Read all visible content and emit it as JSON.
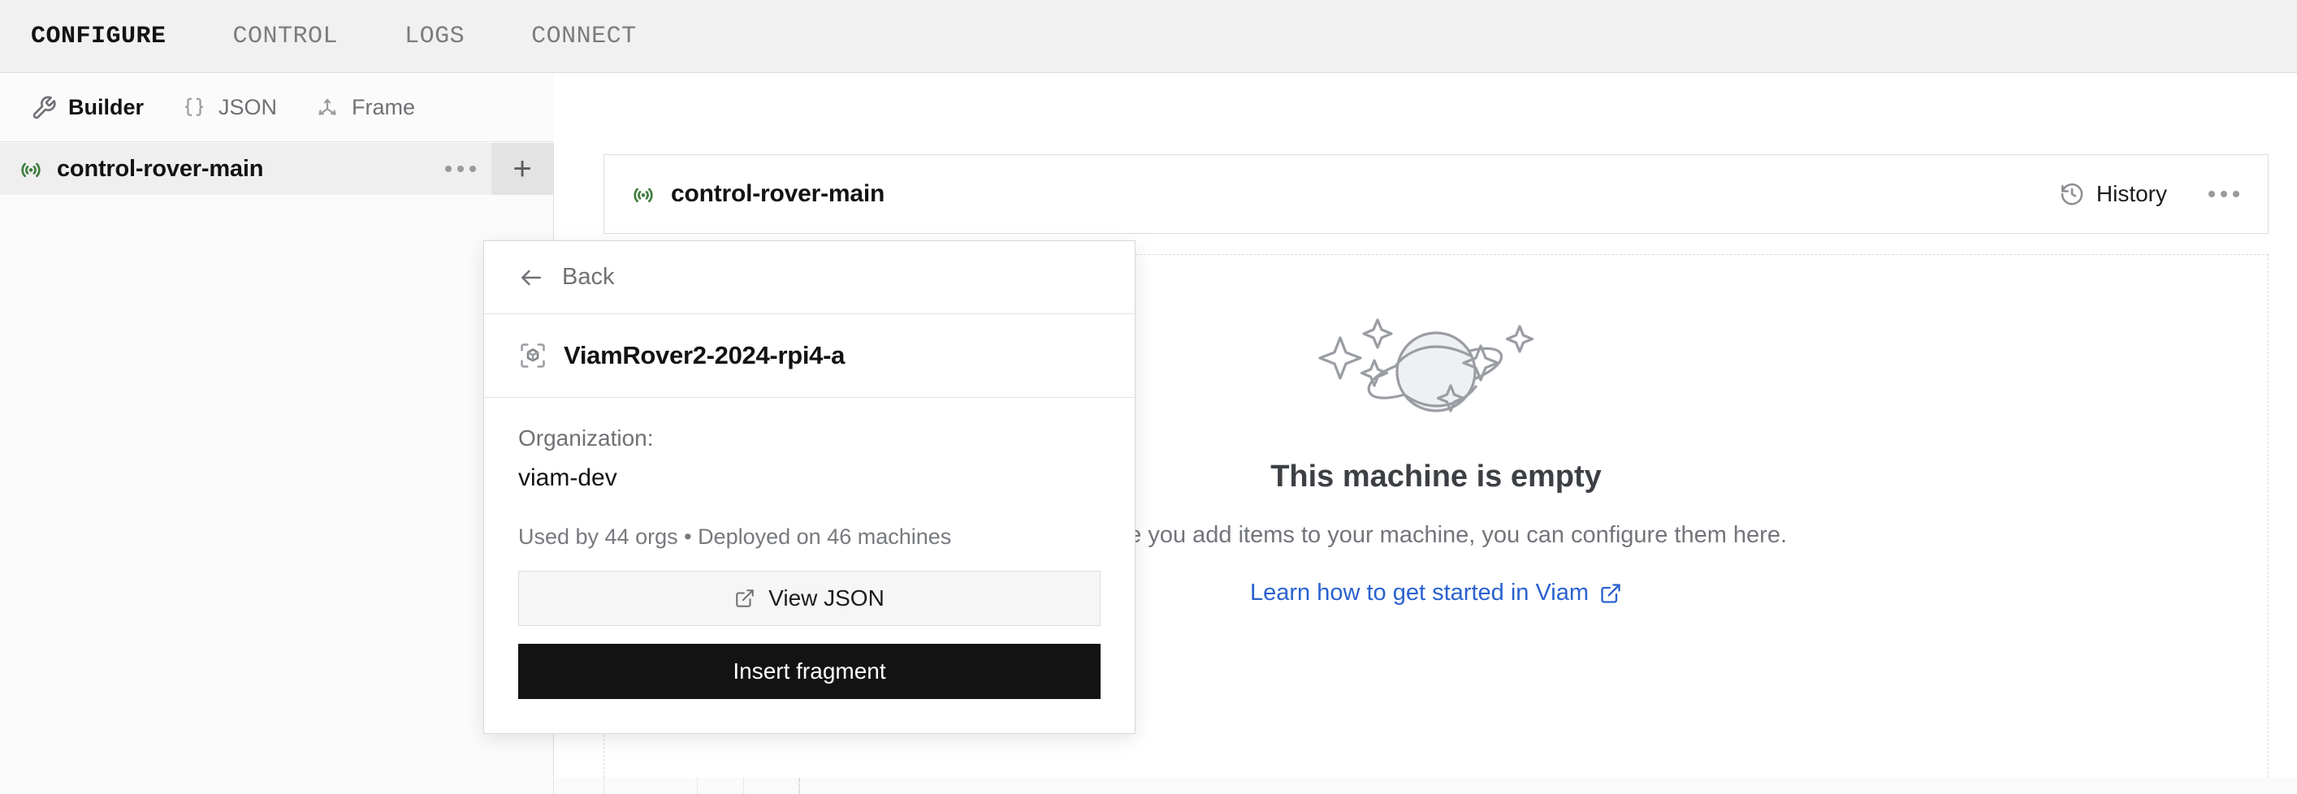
{
  "topnav": {
    "items": [
      {
        "label": "CONFIGURE",
        "active": true
      },
      {
        "label": "CONTROL",
        "active": false
      },
      {
        "label": "LOGS",
        "active": false
      },
      {
        "label": "CONNECT",
        "active": false
      }
    ]
  },
  "subbar": {
    "items": [
      {
        "label": "Builder",
        "icon": "tools-icon",
        "active": true
      },
      {
        "label": "JSON",
        "icon": "braces-icon",
        "active": false
      },
      {
        "label": "Frame",
        "icon": "axes-icon",
        "active": false
      }
    ]
  },
  "sidebar": {
    "tree": {
      "label": "control-rover-main",
      "icon": "broadcast-icon",
      "menu_label": "more-options",
      "add_label": "+"
    }
  },
  "main": {
    "machine_card": {
      "title": "control-rover-main",
      "icon": "broadcast-icon",
      "history_label": "History",
      "menu_label": "more-options"
    },
    "empty_state": {
      "illustration": "planet-sparkles-illustration",
      "title": "This machine is empty",
      "subtitle": "Once you add items to your machine, you can configure them here.",
      "link_label": "Learn how to get started in Viam"
    }
  },
  "popup": {
    "back_label": "Back",
    "fragment_name": "ViamRover2-2024-rpi4-a",
    "fragment_icon": "fragment-cube-icon",
    "org_label": "Organization:",
    "org_value": "viam-dev",
    "usage": "Used by 44 orgs • Deployed on 46 machines",
    "view_json_label": "View JSON",
    "insert_label": "Insert fragment"
  },
  "colors": {
    "accent_link": "#2a61cf",
    "node_green": "#3f7f3f",
    "primary_button": "#131313",
    "nav_bg": "#f1f1f1"
  }
}
